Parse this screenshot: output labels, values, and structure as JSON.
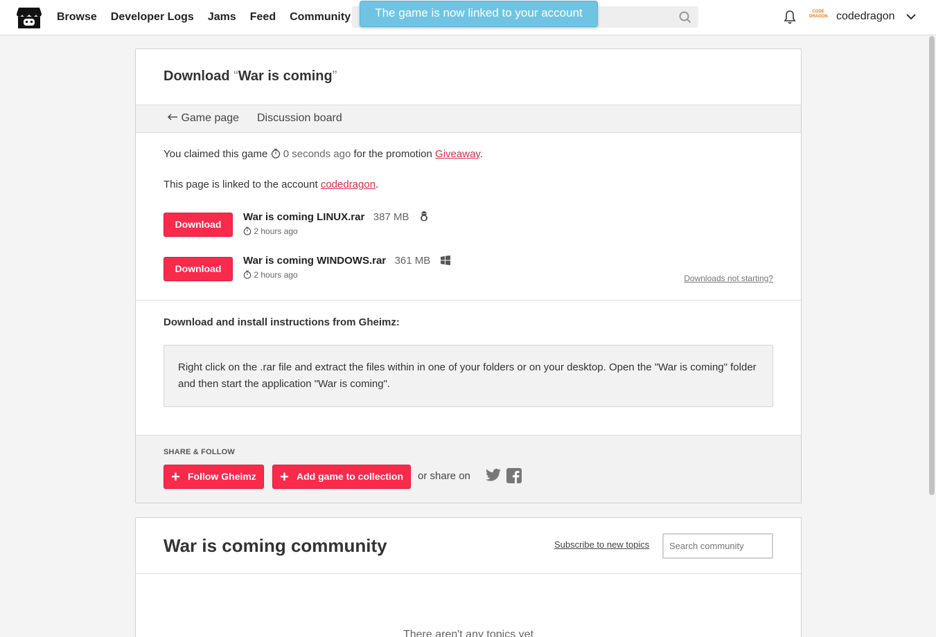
{
  "header": {
    "nav": [
      "Browse",
      "Developer Logs",
      "Jams",
      "Feed",
      "Community"
    ],
    "toast": "The game is now linked to your account",
    "avatar_text": "CODE DRAGON",
    "username": "codedragon"
  },
  "download": {
    "title_prefix": "Download",
    "game_name": "War is coming",
    "tab_game_page": "Game page",
    "tab_discussion": "Discussion board",
    "claimed_text": "You claimed this game",
    "claimed_time": "0 seconds ago",
    "promotion_text": "for the promotion",
    "promotion_link": "Giveaway",
    "linked_text": "This page is linked to the account",
    "linked_account": "codedragon",
    "files": [
      {
        "button": "Download",
        "name": "War is coming LINUX.rar",
        "size": "387 MB",
        "platform": "linux-icon",
        "time": "2 hours ago"
      },
      {
        "button": "Download",
        "name": "War is coming WINDOWS.rar",
        "size": "361 MB",
        "platform": "windows-icon",
        "time": "2 hours ago"
      }
    ],
    "not_starting": "Downloads not starting?",
    "instructions_title": "Download and install instructions from Gheimz:",
    "instructions_body": "Right click on the .rar file and extract the files within in one of your folders or on your desktop. Open the \"War is coming\" folder and then start the application \"War is coming\".",
    "share_label": "SHARE & FOLLOW",
    "follow_button": "Follow Gheimz",
    "collection_button": "Add game to collection",
    "or_share": "or share on"
  },
  "community": {
    "title": "War is coming community",
    "subscribe": "Subscribe to new topics",
    "search_placeholder": "Search community",
    "empty": "There aren't any topics yet"
  },
  "colors": {
    "accent": "#fa2a4a",
    "toast": "#6fc4e4",
    "link": "#da2c49"
  }
}
